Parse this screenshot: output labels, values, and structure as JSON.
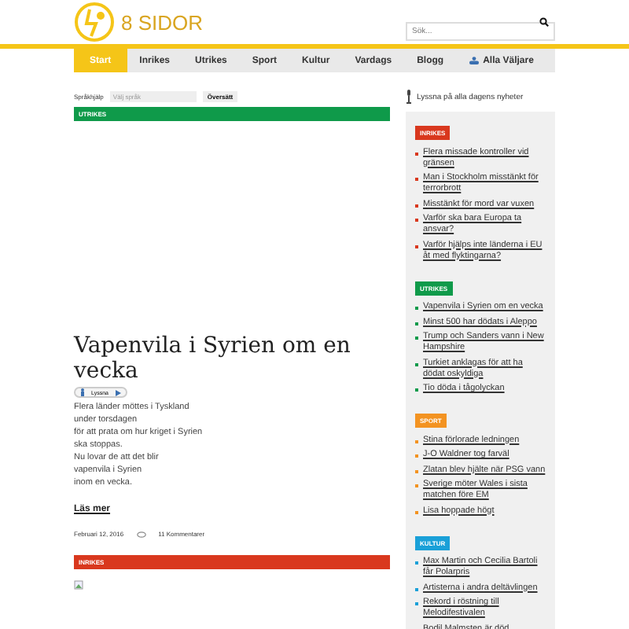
{
  "logo": {
    "text": "8 SIDOR"
  },
  "search": {
    "placeholder": "Sök..."
  },
  "nav": [
    {
      "label": "Start",
      "selected": true,
      "kind": "plain"
    },
    {
      "label": "Inrikes",
      "selected": false,
      "kind": "plain"
    },
    {
      "label": "Utrikes",
      "selected": false,
      "kind": "plain"
    },
    {
      "label": "Sport",
      "selected": false,
      "kind": "plain"
    },
    {
      "label": "Kultur",
      "selected": false,
      "kind": "plain"
    },
    {
      "label": "Vardags",
      "selected": false,
      "kind": "plain"
    },
    {
      "label": "Blogg",
      "selected": false,
      "kind": "plain"
    },
    {
      "label": "Alla Väljare",
      "selected": false,
      "kind": "group"
    }
  ],
  "translate": {
    "label": "Språkhjälp",
    "select_value": "Välj språk",
    "button": "Översätt"
  },
  "listen_all": "Lyssna på alla dagens nyheter",
  "articles": [
    {
      "category": "UTRIKES",
      "color": "#0f9a4a",
      "title": "Vapenvila i Syrien om en vecka",
      "listen": "Lyssna",
      "body": [
        "Flera länder möttes i Tyskland",
        "under torsdagen",
        "för att prata om hur kriget i Syrien",
        "ska stoppas.",
        "Nu lovar de att det blir",
        "vapenvila i Syrien",
        "inom en vecka."
      ],
      "more": "Läs mer",
      "date": "Februari 12, 2016",
      "comments": "11 Kommentarer"
    },
    {
      "category": "INRIKES",
      "color": "#d9381e"
    }
  ],
  "sidebar": [
    {
      "label": "INRIKES",
      "color": "#d9381e",
      "items": [
        "Flera missade kontroller vid gränsen",
        "Man i Stockholm misstänkt för terrorbrott",
        "Misstänkt för mord var vuxen",
        "Varför ska bara Europa ta ansvar?",
        "Varför hjälps inte länderna i EU åt med flyktingarna?"
      ]
    },
    {
      "label": "UTRIKES",
      "color": "#0f9a4a",
      "items": [
        "Vapenvila i Syrien om en vecka",
        "Minst 500 har dödats i Aleppo",
        "Trump och Sanders vann i New Hampshire",
        "Turkiet anklagas för att ha dödat oskyldiga",
        "Tio döda i tågolyckan"
      ]
    },
    {
      "label": "SPORT",
      "color": "#f39321",
      "items": [
        "Stina förlorade ledningen",
        "J-O Waldner tog farväl",
        "Zlatan blev hjälte när PSG vann",
        "Sverige möter Wales i sista matchen före EM",
        "Lisa hoppade högt"
      ]
    },
    {
      "label": "KULTUR",
      "color": "#1aa0d8",
      "items": [
        "Max Martin och Cecilia Bartoli får Polarpris",
        "Artisterna i andra deltävlingen",
        "Rekord i röstning till Melodifestivalen",
        "Bodil Malmsten är död"
      ]
    }
  ]
}
